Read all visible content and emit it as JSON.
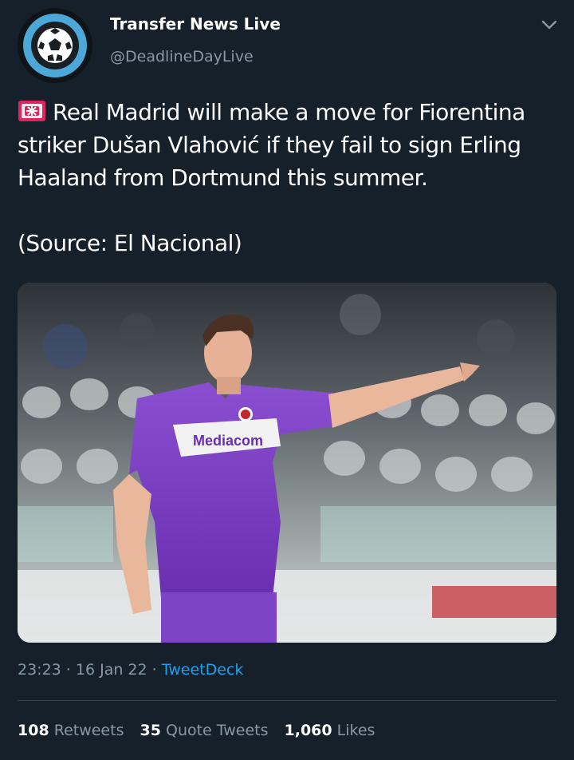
{
  "account": {
    "display_name": "Transfer News Live",
    "handle": "@DeadlineDayLive",
    "avatar_icon": "soccer-ball-icon",
    "avatar_ring_color": "#4ba8d8"
  },
  "menu": {
    "icon": "chevron-down-icon"
  },
  "tweet": {
    "emoji_icon": "rotating-siren-icon",
    "text": "Real Madrid will make a move for Fiorentina\nstriker Dušan Vlahović if they fail to sign Erling\nHaaland from Dortmund this summer.\n\n(Source: El Nacional)",
    "media": {
      "sponsor": "Mediacom",
      "jersey_color": "#7b3fbf"
    }
  },
  "meta": {
    "time": "23:23",
    "separator": " · ",
    "date": "16 Jan 22",
    "source": "TweetDeck"
  },
  "stats": [
    {
      "count": "108",
      "label": "Retweets"
    },
    {
      "count": "35",
      "label": "Quote Tweets"
    },
    {
      "count": "1,060",
      "label": "Likes"
    }
  ],
  "colors": {
    "background": "#15202b",
    "secondary_text": "#8899a6",
    "link": "#1da1f2",
    "divider": "#38444d"
  }
}
